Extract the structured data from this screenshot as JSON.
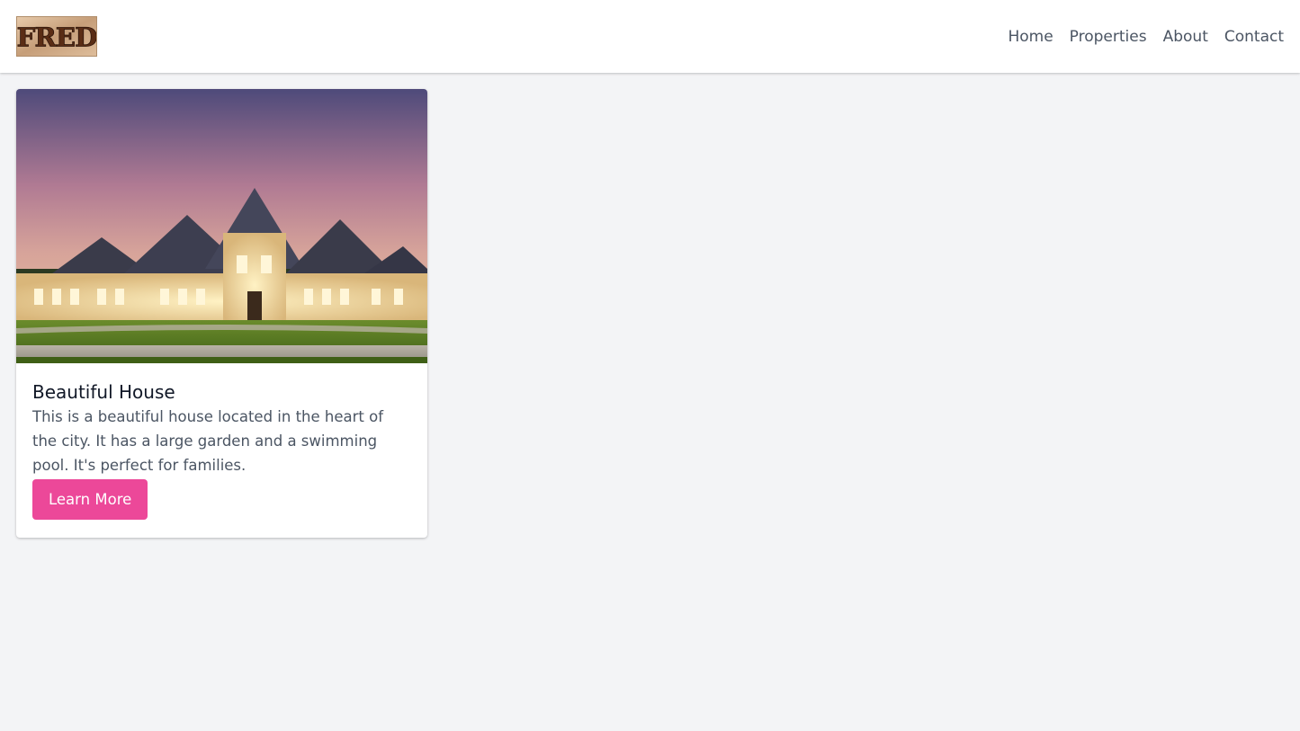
{
  "brand": {
    "logo_text": "FRED"
  },
  "nav": {
    "items": [
      {
        "label": "Home"
      },
      {
        "label": "Properties"
      },
      {
        "label": "About"
      },
      {
        "label": "Contact"
      }
    ]
  },
  "listing": {
    "title": "Beautiful House",
    "description": "This is a beautiful house located in the heart of the city. It has a large garden and a swimming pool. It's perfect for families.",
    "button_label": "Learn More"
  },
  "colors": {
    "page_background": "#f3f4f6",
    "accent": "#ec4899",
    "nav_text": "#4b5563"
  }
}
